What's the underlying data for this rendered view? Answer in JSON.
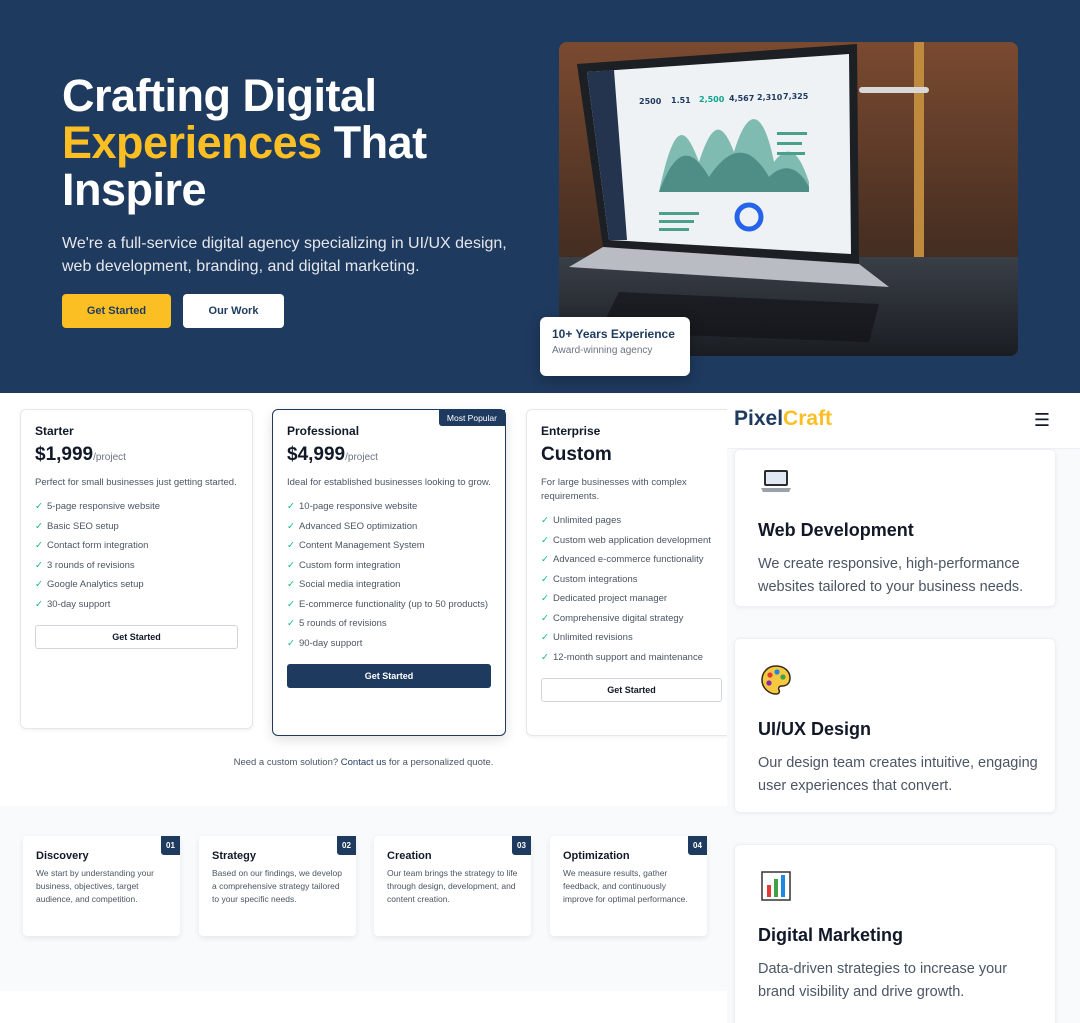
{
  "hero": {
    "title_line1": "Crafting Digital",
    "title_accent": "Experiences",
    "title_line2_rest": " That",
    "title_line3": "Inspire",
    "subtitle": "We're a full-service digital agency specializing in UI/UX design, web development, branding, and digital marketing.",
    "cta_primary": "Get Started",
    "cta_secondary": "Our Work",
    "badge_title": "10+ Years Experience",
    "badge_sub": "Award-winning agency",
    "dashboard_stats": [
      "2500",
      "1.51",
      "2,500",
      "4,567",
      "2,310",
      "7,325"
    ]
  },
  "pricing": {
    "plans": [
      {
        "name": "Starter",
        "price": "$1,999",
        "per": "/project",
        "desc": "Perfect for small businesses just getting started.",
        "features": [
          "5-page responsive website",
          "Basic SEO setup",
          "Contact form integration",
          "3 rounds of revisions",
          "Google Analytics setup",
          "30-day support"
        ],
        "button": "Get Started"
      },
      {
        "name": "Professional",
        "price": "$4,999",
        "per": "/project",
        "badge": "Most Popular",
        "desc": "Ideal for established businesses looking to grow.",
        "features": [
          "10-page responsive website",
          "Advanced SEO optimization",
          "Content Management System",
          "Custom form integration",
          "Social media integration",
          "E-commerce functionality (up to 50 products)",
          "5 rounds of revisions",
          "90-day support"
        ],
        "button": "Get Started"
      },
      {
        "name": "Enterprise",
        "price": "Custom",
        "per": "",
        "desc": "For large businesses with complex requirements.",
        "features": [
          "Unlimited pages",
          "Custom web application development",
          "Advanced e-commerce functionality",
          "Custom integrations",
          "Dedicated project manager",
          "Comprehensive digital strategy",
          "Unlimited revisions",
          "12-month support and maintenance"
        ],
        "button": "Get Started"
      }
    ],
    "note_before": "Need a custom solution? ",
    "note_link": "Contact us",
    "note_after": " for a personalized quote."
  },
  "process": {
    "steps": [
      {
        "num": "01",
        "title": "Discovery",
        "desc": "We start by understanding your business, objectives, target audience, and competition."
      },
      {
        "num": "02",
        "title": "Strategy",
        "desc": "Based on our findings, we develop a comprehensive strategy tailored to your specific needs."
      },
      {
        "num": "03",
        "title": "Creation",
        "desc": "Our team brings the strategy to life through design, development, and content creation."
      },
      {
        "num": "04",
        "title": "Optimization",
        "desc": "We measure results, gather feedback, and continuously improve for optimal performance."
      }
    ]
  },
  "mobile": {
    "logo_main": "Pixel",
    "logo_accent": "Craft",
    "menu_icon": "menu-icon",
    "services": [
      {
        "icon": "laptop-icon",
        "title": "Web Development",
        "desc": "We create responsive, high-performance websites tailored to your business needs."
      },
      {
        "icon": "palette-icon",
        "title": "UI/UX Design",
        "desc": "Our design team creates intuitive, engaging user experiences that convert."
      },
      {
        "icon": "bar-chart-icon",
        "title": "Digital Marketing",
        "desc": "Data-driven strategies to increase your brand visibility and drive growth."
      }
    ]
  },
  "colors": {
    "navy": "#1e3a5f",
    "accent": "#fbbf24",
    "check": "#10b981"
  }
}
